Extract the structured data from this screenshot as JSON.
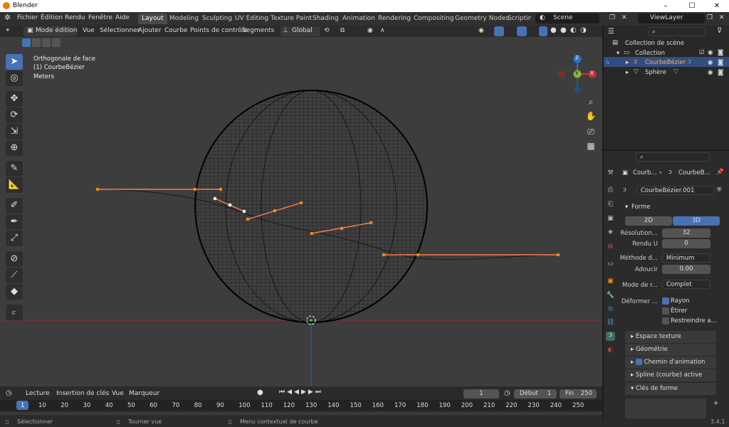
{
  "window": {
    "title": "Blender",
    "version": "3.4.1"
  },
  "menu": [
    "Fichier",
    "Édition",
    "Rendu",
    "Fenêtre",
    "Aide"
  ],
  "workspaces": [
    "Layout",
    "Modeling",
    "Sculpting",
    "UV Editing",
    "Texture Paint",
    "Shading",
    "Animation",
    "Rendering",
    "Compositing",
    "Geometry Nodes",
    "Scripting"
  ],
  "scene": {
    "name": "Scene",
    "view_layer": "ViewLayer"
  },
  "viewport_header": {
    "mode": "Mode édition",
    "items": [
      "Vue",
      "Sélectionner",
      "Ajouter",
      "Courbe",
      "Points de contrôle",
      "Segments"
    ],
    "transform": "Global"
  },
  "overlay": {
    "view": "Orthogonale de face",
    "object": "(1) CourbeBézier",
    "units": "Meters"
  },
  "gizmo": {
    "x": "X",
    "y": "Y",
    "z": "Z"
  },
  "outliner": {
    "scene_collection": "Collection de scène",
    "collection": "Collection",
    "items": [
      "CourbeBézier",
      "Sphère"
    ]
  },
  "properties": {
    "breadcrumb": [
      "Courb...",
      "CourbeB..."
    ],
    "datablock": "CourbeBézier.001",
    "section_shape": "Forme",
    "toggle_2d": "2D",
    "toggle_3d": "3D",
    "fields": [
      {
        "label": "Résolution...",
        "value": "32"
      },
      {
        "label": "Rendu U",
        "value": "0"
      }
    ],
    "twist_label": "Méthode d...",
    "twist_value": "Minimum",
    "smooth_label": "Adoucir",
    "smooth_value": "0.00",
    "fill_label": "Mode de r...",
    "fill_value": "Complet",
    "deform_label": "Déformer ...",
    "checks": [
      {
        "label": "Rayon",
        "on": true
      },
      {
        "label": "Étirer",
        "on": false
      },
      {
        "label": "Restreindre a...",
        "on": false
      }
    ],
    "sections": [
      "Espace texture",
      "Géométrie",
      "Chemin d'animation",
      "Spline (courbe) active",
      "Clés de forme"
    ]
  },
  "timeline": {
    "playback": "Lecture",
    "keying": "Insertion de clés",
    "view": "Vue",
    "marker": "Marqueur",
    "current_frame": "1",
    "start_label": "Début",
    "start": "1",
    "end_label": "Fin",
    "end": "250",
    "ticks": [
      "1",
      "10",
      "20",
      "30",
      "40",
      "50",
      "60",
      "70",
      "80",
      "90",
      "100",
      "110",
      "120",
      "130",
      "140",
      "150",
      "160",
      "170",
      "180",
      "190",
      "200",
      "210",
      "220",
      "230",
      "240",
      "250"
    ]
  },
  "status": {
    "select": "Sélectionner",
    "rotate": "Tourner vue",
    "context": "Menu contextuel de courbe"
  },
  "colors": {
    "accent": "#4772b3",
    "curve": "#ff7f50",
    "handle": "#ff8c00",
    "axis_x": "#c6303b",
    "axis_z": "#2b6fd6"
  }
}
